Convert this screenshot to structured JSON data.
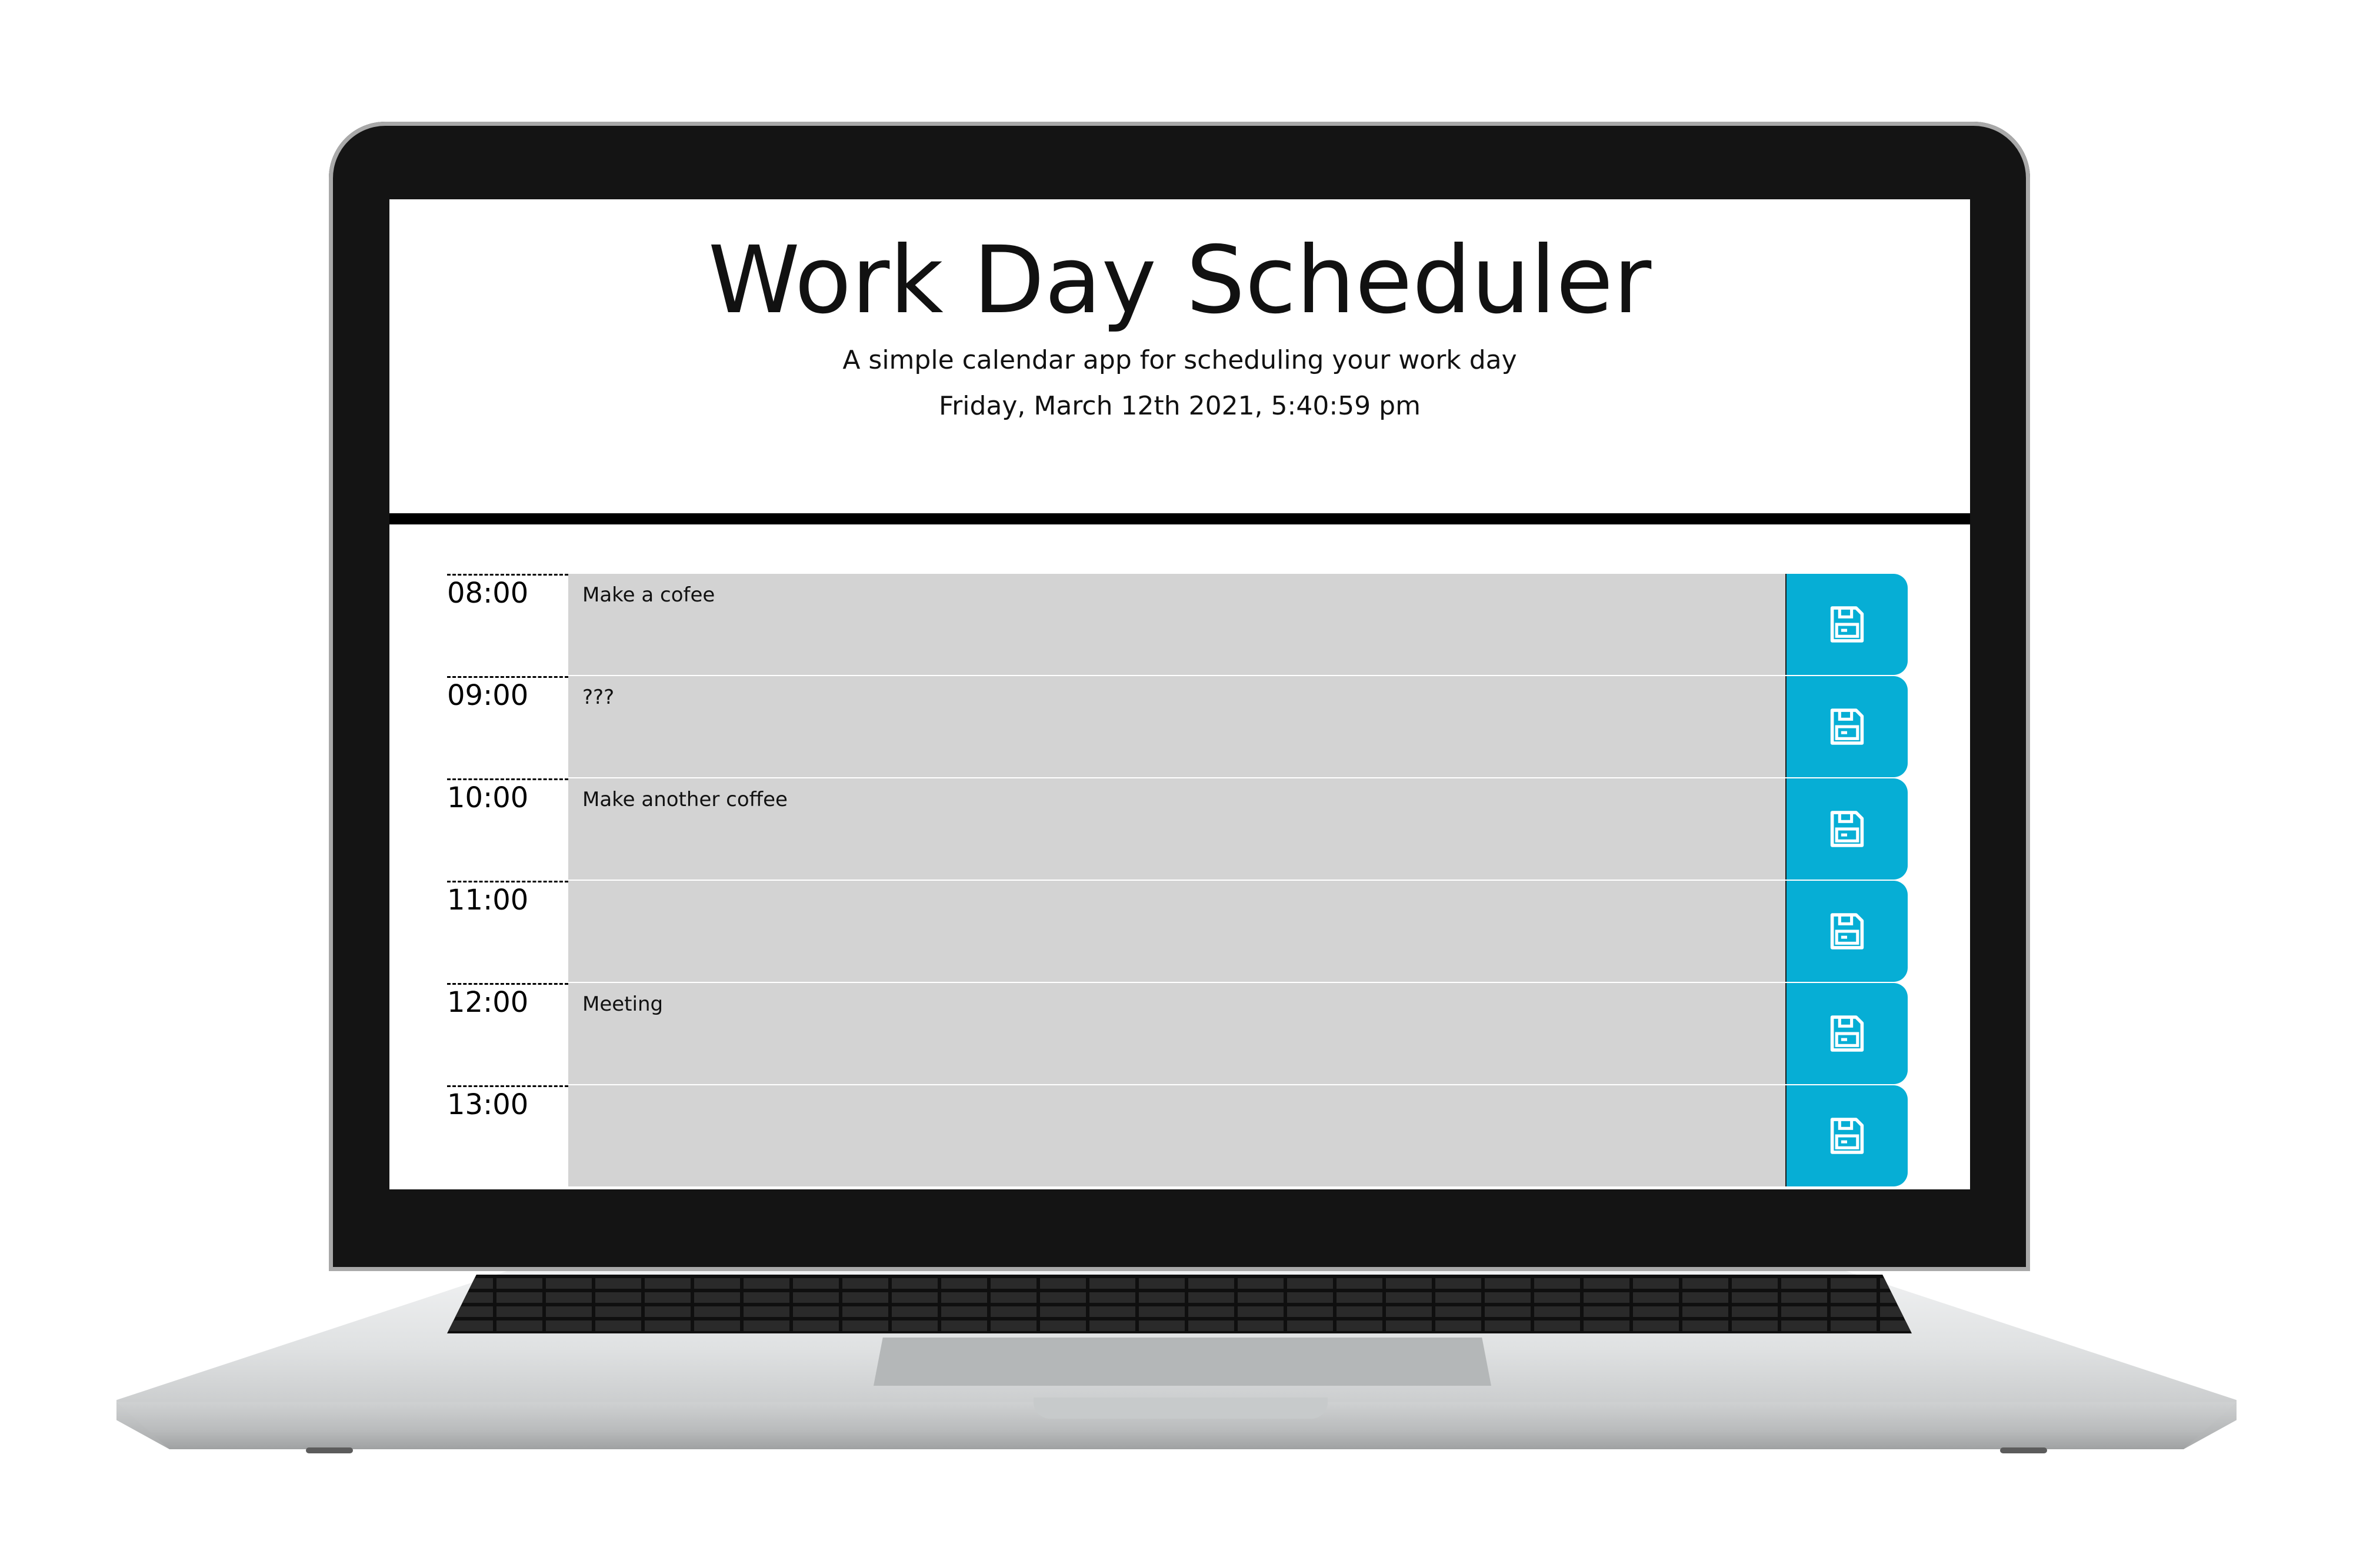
{
  "header": {
    "title": "Work Day Scheduler",
    "subtitle": "A simple calendar app for scheduling your work day",
    "current_day": "Friday, March 12th 2021, 5:40:59 pm"
  },
  "time_blocks": [
    {
      "hour": "08:00",
      "text": "Make a cofee",
      "icon": "save-icon"
    },
    {
      "hour": "09:00",
      "text": "???",
      "icon": "save-icon"
    },
    {
      "hour": "10:00",
      "text": "Make another coffee",
      "icon": "save-icon"
    },
    {
      "hour": "11:00",
      "text": "",
      "icon": "save-icon"
    },
    {
      "hour": "12:00",
      "text": "Meeting",
      "icon": "save-icon"
    },
    {
      "hour": "13:00",
      "text": "",
      "icon": "save-icon"
    }
  ],
  "colors": {
    "save_button": "#06aed5",
    "past_block": "#d3d3d3",
    "header_rule": "#000000"
  }
}
